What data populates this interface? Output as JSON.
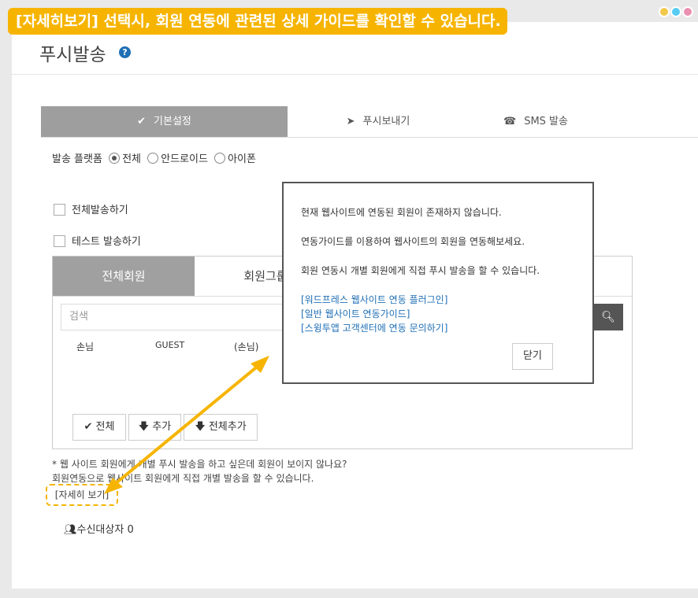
{
  "banner": {
    "text": "[자세히보기] 선택시, 회원 연동에 관련된 상세 가이드를 확인할 수 있습니다."
  },
  "window_dots": {
    "colors": [
      "#f2c94c",
      "#56ccf2",
      "#eb8fb0"
    ]
  },
  "page": {
    "title": "푸시발송",
    "help_icon": "?"
  },
  "tabs": [
    {
      "label": "기본설정",
      "icon": "✔",
      "active": true
    },
    {
      "label": "푸시보내기",
      "icon": "➤",
      "active": false
    },
    {
      "label": "SMS 발송",
      "icon": "☎",
      "active": false
    }
  ],
  "platform": {
    "label": "발송 플랫폼",
    "options": [
      "전체",
      "안드로이드",
      "아이폰"
    ],
    "selected": "전체"
  },
  "checks": {
    "send_all": "전체발송하기",
    "test_send": "테스트 발송하기"
  },
  "member_panel": {
    "tabs": [
      "전체회원",
      "회원그룹"
    ],
    "search_placeholder": "검색",
    "row": {
      "name": "손님",
      "grade": "GUEST",
      "display": "(손님)"
    },
    "buttons": {
      "all": "전체",
      "add": "추가",
      "add_all": "전체추가"
    }
  },
  "notes": {
    "line1": "* 웹 사이트 회원에게 개별 푸시 발송을 하고 싶은데 회원이 보이지 않나요?",
    "line2": "회원연동으로 웹사이트 회원에게 직접 개별 발송을 할 수 있습니다.",
    "detail_link": "[자세히 보기]"
  },
  "recipients": {
    "label": "수신대상자",
    "count": "0"
  },
  "modal": {
    "line1": "현재 웹사이트에 연동된 회원이 존재하지 않습니다.",
    "line2": "연동가이드를 이용하여 웹사이트의 회원을 연동해보세요.",
    "line3": "회원 연동시 개별 회원에게 직접 푸시 발송을 할 수 있습니다.",
    "links": [
      "[워드프레스 웹사이트 연동 플러그인]",
      "[일반 웹사이트 연동가이드]",
      "[스윙투앱 고객센터에 연동 문의하기]"
    ],
    "close": "닫기"
  },
  "accent_color": "#f6b400"
}
